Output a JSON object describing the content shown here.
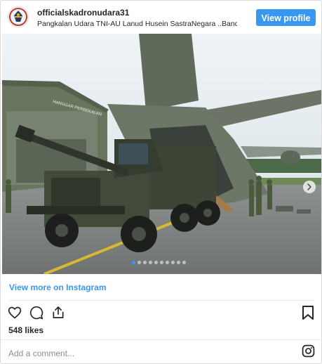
{
  "post": {
    "username": "officialskadronudara31",
    "location": "Pangkalan Udara TNI-AU Lanud Husein SastraNegara ..Bandung",
    "view_profile_label": "View profile",
    "photo_signage": "HANGGAR PERBEKALAN",
    "carousel": {
      "count": 10,
      "active_index": 0
    },
    "view_more_label": "View more on Instagram",
    "likes": "548 likes",
    "comment_placeholder": "Add a comment..."
  },
  "icons": {
    "avatar": "squadron-emblem",
    "carousel_next": "chevron-right-icon",
    "like": "heart-icon",
    "comment": "comment-icon",
    "share": "share-icon",
    "save": "bookmark-icon",
    "instagram": "instagram-icon"
  },
  "colors": {
    "accent": "#3897f0",
    "text": "#262626",
    "muted": "#8e8e8e",
    "border": "#dbdbdb"
  }
}
